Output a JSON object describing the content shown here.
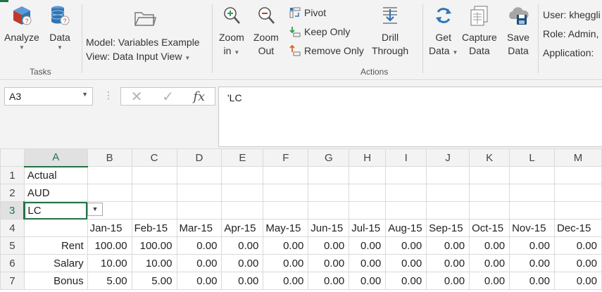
{
  "ribbon": {
    "tasks": {
      "analyze_label": "Analyze",
      "data_label": "Data",
      "group_label": "Tasks"
    },
    "model": {
      "model_text": "Model: Variables Example",
      "view_text": "View: Data Input View"
    },
    "actions": {
      "zoom_in_line1": "Zoom",
      "zoom_in_line2": "in",
      "zoom_out_line1": "Zoom",
      "zoom_out_line2": "Out",
      "pivot_label": "Pivot",
      "keep_only_label": "Keep Only",
      "remove_only_label": "Remove Only",
      "drill_line1": "Drill",
      "drill_line2": "Through",
      "get_data_line1": "Get",
      "get_data_line2": "Data",
      "capture_line1": "Capture",
      "capture_line2": "Data",
      "save_line1": "Save",
      "save_line2": "Data",
      "group_label": "Actions"
    },
    "user": {
      "user_text": "User: kheggli",
      "role_text": "Role: Admin,",
      "application_text": "Application:"
    }
  },
  "formula_bar": {
    "name_box": "A3",
    "fx_symbol": "fx",
    "formula": "'LC"
  },
  "grid": {
    "column_headers": [
      "A",
      "B",
      "C",
      "D",
      "E",
      "F",
      "G",
      "H",
      "I",
      "J",
      "K",
      "L",
      "M"
    ],
    "row_numbers": [
      "1",
      "2",
      "3",
      "4",
      "5",
      "6",
      "7"
    ],
    "a1": "Actual",
    "a2": "AUD",
    "a3": "LC",
    "months": [
      "Jan-15",
      "Feb-15",
      "Mar-15",
      "Apr-15",
      "May-15",
      "Jun-15",
      "Jul-15",
      "Aug-15",
      "Sep-15",
      "Oct-15",
      "Nov-15",
      "Dec-15"
    ],
    "rows": [
      {
        "label": "Rent",
        "values": [
          "100.00",
          "100.00",
          "0.00",
          "0.00",
          "0.00",
          "0.00",
          "0.00",
          "0.00",
          "0.00",
          "0.00",
          "0.00",
          "0.00"
        ]
      },
      {
        "label": "Salary",
        "values": [
          "10.00",
          "10.00",
          "0.00",
          "0.00",
          "0.00",
          "0.00",
          "0.00",
          "0.00",
          "0.00",
          "0.00",
          "0.00",
          "0.00"
        ]
      },
      {
        "label": "Bonus",
        "values": [
          "5.00",
          "5.00",
          "0.00",
          "0.00",
          "0.00",
          "0.00",
          "0.00",
          "0.00",
          "0.00",
          "0.00",
          "0.00",
          "0.00"
        ]
      }
    ]
  },
  "colors": {
    "accent": "#217346",
    "ribbon_bg": "#f3f3f3",
    "icon_blue": "#2e75b6",
    "icon_red": "#c0392b"
  }
}
